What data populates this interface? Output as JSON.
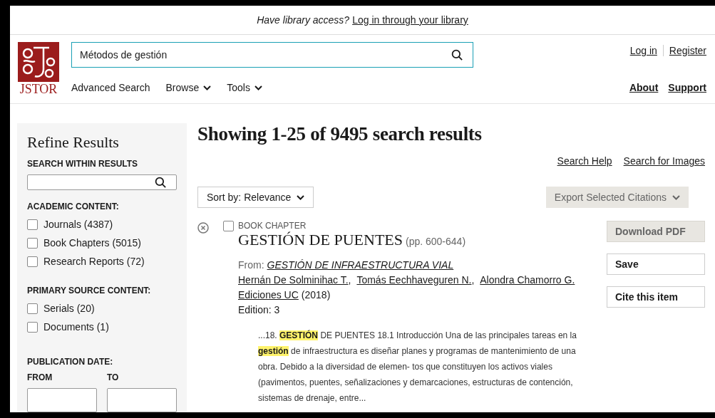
{
  "library_banner": {
    "prompt": "Have library access?",
    "link": "Log in through your library"
  },
  "header": {
    "logo_text": "JSTOR",
    "search": {
      "value": "Métodos de gestión"
    },
    "nav": [
      {
        "label": "Advanced Search",
        "kind": "link"
      },
      {
        "label": "Browse",
        "kind": "menu"
      },
      {
        "label": "Tools",
        "kind": "menu"
      }
    ],
    "account_links": [
      "Log in",
      "Register"
    ],
    "info_links": [
      "About",
      "Support"
    ]
  },
  "sidebar": {
    "title": "Refine Results",
    "search_within": {
      "label": "SEARCH WITHIN RESULTS"
    },
    "groups": [
      {
        "heading": "ACADEMIC CONTENT:",
        "options": [
          {
            "label": "Journals (4387)",
            "checked": false
          },
          {
            "label": "Book Chapters (5015)",
            "checked": false
          },
          {
            "label": "Research Reports (72)",
            "checked": false
          }
        ]
      },
      {
        "heading": "PRIMARY SOURCE CONTENT:",
        "options": [
          {
            "label": "Serials (20)",
            "checked": false
          },
          {
            "label": "Documents (1)",
            "checked": false
          }
        ]
      }
    ],
    "publication_date": {
      "heading": "PUBLICATION DATE:",
      "from_label": "FROM",
      "to_label": "TO"
    }
  },
  "results": {
    "heading": "Showing 1-25 of 9495 search results",
    "help_links": [
      "Search Help",
      "Search for Images"
    ],
    "sort": {
      "label": "Sort by: Relevance"
    },
    "export": {
      "label": "Export Selected Citations",
      "disabled": true
    },
    "items": [
      {
        "type": "BOOK CHAPTER",
        "checked": false,
        "title": "GESTIÓN DE PUENTES",
        "pages": "(pp. 600-644)",
        "from_label": "From:",
        "from_title": "GESTIÓN DE INFRAESTRUCTURA VIAL",
        "authors": [
          "Hernán De Solminihac T.",
          ", ",
          "Tomás Eechhaveguren N.",
          ", ",
          "Alondra Chamorro G."
        ],
        "publisher": "Ediciones UC",
        "year": "(2018)",
        "edition": "Edition: 3",
        "snippet": "...18. **GESTIÓN** DE PUENTES 18.1 Introducción Una de las principales tareas en la **gestión** de infraestructura es diseñar planes y programas de mantenimiento de una obra. Debido a la diversidad de elemen- tos que constituyen los activos viales (pavimentos, puentes, señalizaciones y demarcaciones, estructuras de contención, sistemas de drenaje, entre...",
        "actions": [
          {
            "label": "Download PDF",
            "disabled": true
          },
          {
            "label": "Save",
            "disabled": false
          },
          {
            "label": "Cite this item",
            "disabled": false
          }
        ]
      }
    ]
  }
}
